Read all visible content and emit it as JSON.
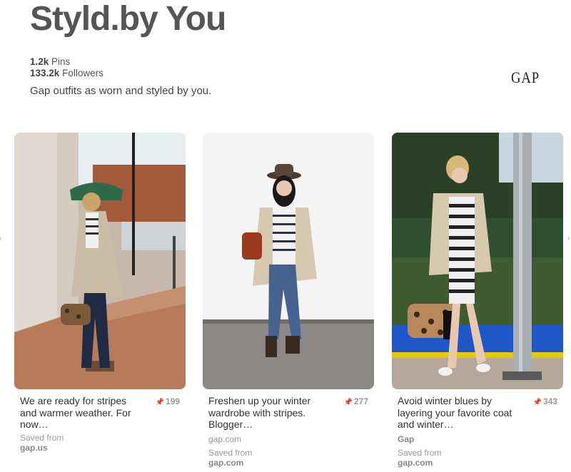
{
  "board": {
    "title": "Styld.by You",
    "pins_count": "1.2k",
    "pins_label": "Pins",
    "followers_count": "133.2k",
    "followers_label": "Followers",
    "description": "Gap outfits as worn and styled by you.",
    "brand_logo": "GAP"
  },
  "nav": {
    "left_icon": "chevron-left-icon",
    "right_icon": "chevron-right-icon"
  },
  "pins": [
    {
      "description": "We are ready for stripes and warmer weather. For now…",
      "repin_count": "199",
      "source_label": "Saved from",
      "source_domain": "gap.us"
    },
    {
      "description": "Freshen up your winter wardrobe with stripes. Blogger…",
      "repin_count": "277",
      "site": "gap.com",
      "source_label": "Saved from",
      "source_domain": "gap.com"
    },
    {
      "description": "Avoid winter blues by layering your favorite coat and winter…",
      "repin_count": "343",
      "site": "Gap",
      "source_label": "Saved from",
      "source_domain": "gap.com"
    }
  ]
}
